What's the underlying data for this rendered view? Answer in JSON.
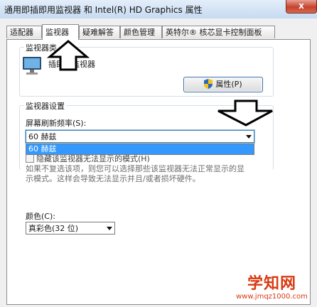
{
  "window": {
    "title": "通用即插即用监视器 和 Intel(R) HD Graphics 属性",
    "close_label": "x"
  },
  "tabs": [
    {
      "label": "适配器"
    },
    {
      "label": "监视器"
    },
    {
      "label": "疑难解答"
    },
    {
      "label": "颜色管理"
    },
    {
      "label": "英特尔® 核芯显卡控制面板"
    }
  ],
  "monitor_type": {
    "group_title": "监视器类",
    "monitor_name": "插即用监视器",
    "properties_button": "属性(P)"
  },
  "monitor_settings": {
    "group_title": "监视器设置",
    "refresh_rate_label": "屏幕刷新频率(S):",
    "refresh_rate_value": "60 赫兹",
    "dropdown_option": "60 赫兹",
    "hide_modes_label": "隐藏该监视器无法显示的模式(H)",
    "description": "如果不复选该项，则您可以选择那些该监视器无法正常显示的显示模式。这样会导致无法显示并且/或者损坏硬件。",
    "color_label": "颜色(C):",
    "color_value": "真彩色(32 位)"
  },
  "watermark": {
    "brand": "学知网",
    "url": "www.jmqz1000.com"
  },
  "colors": {
    "accent": "#3399ff",
    "watermark": "#d83a12"
  }
}
